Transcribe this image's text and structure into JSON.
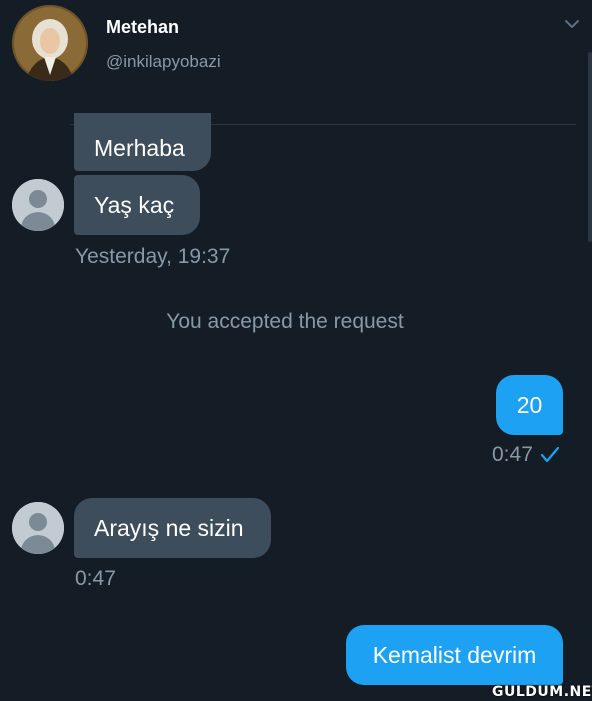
{
  "header": {
    "display_name": "Metehan",
    "handle": "@inkilapyobazi",
    "avatar_icon": "portrait-avatar-icon",
    "menu_icon": "chevron-down-icon"
  },
  "messages": [
    {
      "side": "in",
      "text": "Merhaba"
    },
    {
      "side": "in",
      "text": "Yaş kaç"
    },
    {
      "side": "out",
      "text": "20"
    },
    {
      "side": "in",
      "text": "Arayış ne sizin"
    },
    {
      "side": "out",
      "text": "Kemalist devrim"
    }
  ],
  "timestamps": {
    "first_group": "Yesterday, 19:37",
    "reply_20": "0:47",
    "arayis": "0:47"
  },
  "system_message": "You accepted the request",
  "read_receipt_icon": "checkmark-icon",
  "watermark": "GULDUM.NET",
  "colors": {
    "background": "#141d26",
    "incoming_bubble": "#3d4d5c",
    "outgoing_bubble": "#1da1f2",
    "muted_text": "#8899a6"
  }
}
